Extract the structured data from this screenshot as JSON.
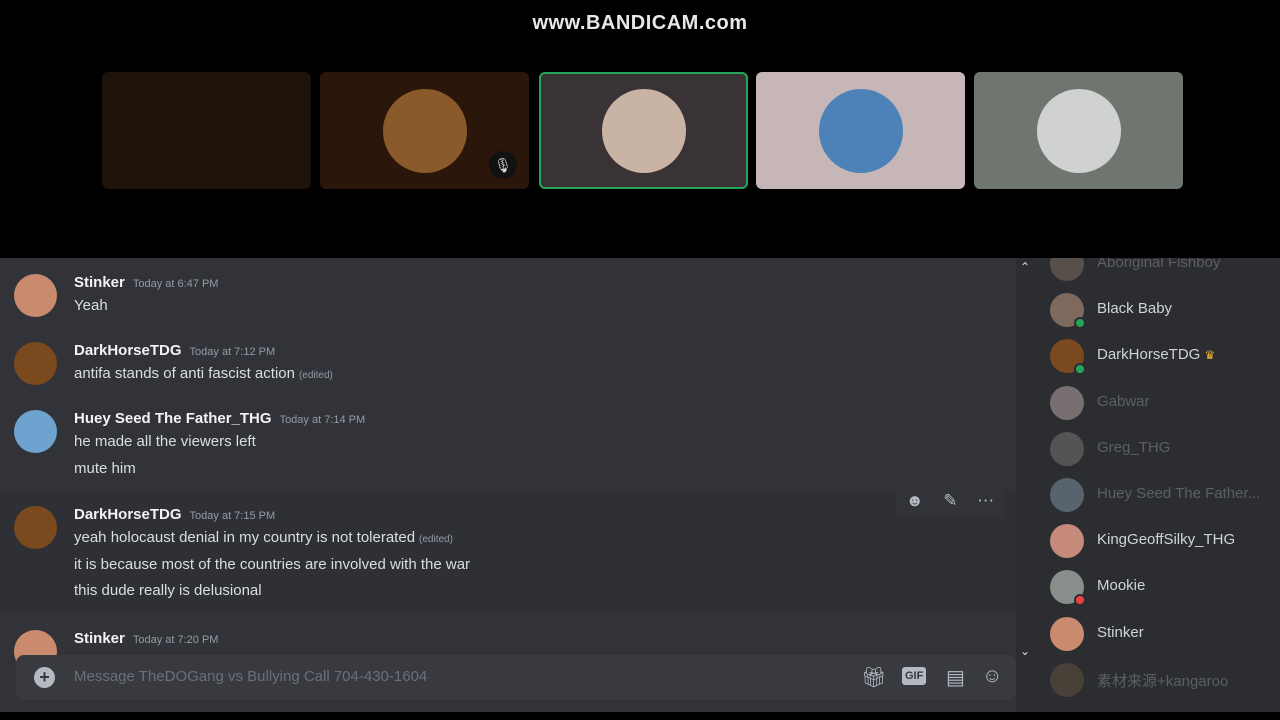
{
  "watermark": "www.BANDICAM.com",
  "tiles": [
    {
      "bg": "#1e130b"
    },
    {
      "bg": "#2a160b",
      "avatar": "#8a5a2a",
      "muted": true
    },
    {
      "bg": "#3a3335",
      "avatar": "#c9b3a5",
      "speaking": true
    },
    {
      "bg": "#c7b6b8",
      "avatar": "#4c82b8"
    },
    {
      "bg": "#6f7670",
      "avatar": "#cfd2d0"
    }
  ],
  "messages": [
    {
      "author": "Stinker",
      "time": "Today at 6:47 PM",
      "avatar": "#c98a6e",
      "lines": [
        {
          "text": "Yeah"
        }
      ]
    },
    {
      "author": "DarkHorseTDG",
      "time": "Today at 7:12 PM",
      "avatar": "#7a4a1e",
      "lines": [
        {
          "text": "antifa stands of anti fascist action",
          "edited": "(edited)"
        }
      ]
    },
    {
      "author": "Huey Seed The Father_THG",
      "time": "Today at 7:14 PM",
      "avatar": "#6ea2cf",
      "lines": [
        {
          "text": "he made all the viewers left"
        },
        {
          "text": "mute him"
        }
      ]
    },
    {
      "author": "DarkHorseTDG",
      "time": "Today at 7:15 PM",
      "avatar": "#7a4a1e",
      "lines": [
        {
          "text": "yeah holocaust denial in my country is not tolerated",
          "edited": "(edited)"
        },
        {
          "text": "it is because most of the countries are involved with the war"
        },
        {
          "text": "this dude really is delusional"
        }
      ]
    },
    {
      "author": "Stinker",
      "time": "Today at 7:20 PM",
      "avatar": "#c98a6e",
      "lines": []
    }
  ],
  "message_tools": [
    "add-reaction-icon",
    "edit-icon",
    "more-icon"
  ],
  "input": {
    "placeholder": "Message TheDOGang vs Bullying Call 704-430-1604",
    "gif_label": "GIF"
  },
  "members": [
    {
      "name": "Aboriginal Fishboy",
      "offline": true,
      "avatar": "#8c7a6a"
    },
    {
      "name": "Black Baby",
      "status": "online",
      "avatar": "#7d6a5c"
    },
    {
      "name": "DarkHorseTDG",
      "status": "online",
      "crown": true,
      "avatar": "#7a4a1e"
    },
    {
      "name": "Gabwar",
      "offline": true,
      "avatar": "#d8c0c0"
    },
    {
      "name": "Greg_THG",
      "offline": true,
      "avatar": "#8a8580"
    },
    {
      "name": "Huey Seed The Father...",
      "offline": true,
      "avatar": "#8fa6b8"
    },
    {
      "name": "KingGeoffSilky_THG",
      "avatar": "#c58a7a"
    },
    {
      "name": "Mookie",
      "status": "dnd",
      "avatar": "#8a8e8a"
    },
    {
      "name": "Stinker",
      "avatar": "#c98a6e"
    },
    {
      "name": "素材来源+kangaroo",
      "offline": true,
      "avatar": "#6a5a40"
    }
  ],
  "colors": {
    "online": "#23a55a",
    "dnd": "#f23f43",
    "crown": "#f0b232",
    "speaking": "#23a55a"
  }
}
